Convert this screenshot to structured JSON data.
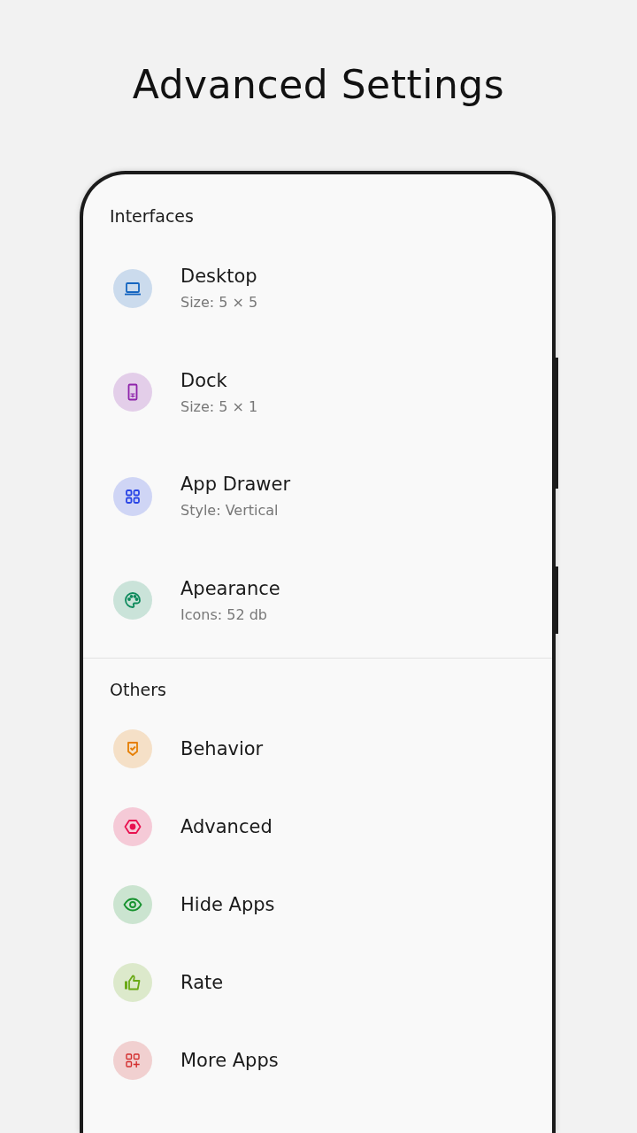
{
  "title": "Advanced Settings",
  "sections": [
    {
      "header": "Interfaces",
      "items": [
        {
          "title": "Desktop",
          "subtitle": "Size: 5 × 5",
          "color": "#1565c0"
        },
        {
          "title": "Dock",
          "subtitle": "Size: 5 × 1",
          "color": "#8e24aa"
        },
        {
          "title": "App Drawer",
          "subtitle": "Style: Vertical",
          "color": "#2945e6"
        },
        {
          "title": "Apearance",
          "subtitle": "Icons: 52 db",
          "color": "#0d8a5c"
        }
      ]
    },
    {
      "header": "Others",
      "items": [
        {
          "title": "Behavior",
          "color": "#e67e00"
        },
        {
          "title": "Advanced",
          "color": "#e8114f"
        },
        {
          "title": "Hide Apps",
          "color": "#16922e"
        },
        {
          "title": "Rate",
          "color": "#6aaa16"
        },
        {
          "title": "More Apps",
          "color": "#d32f2f"
        }
      ]
    }
  ]
}
